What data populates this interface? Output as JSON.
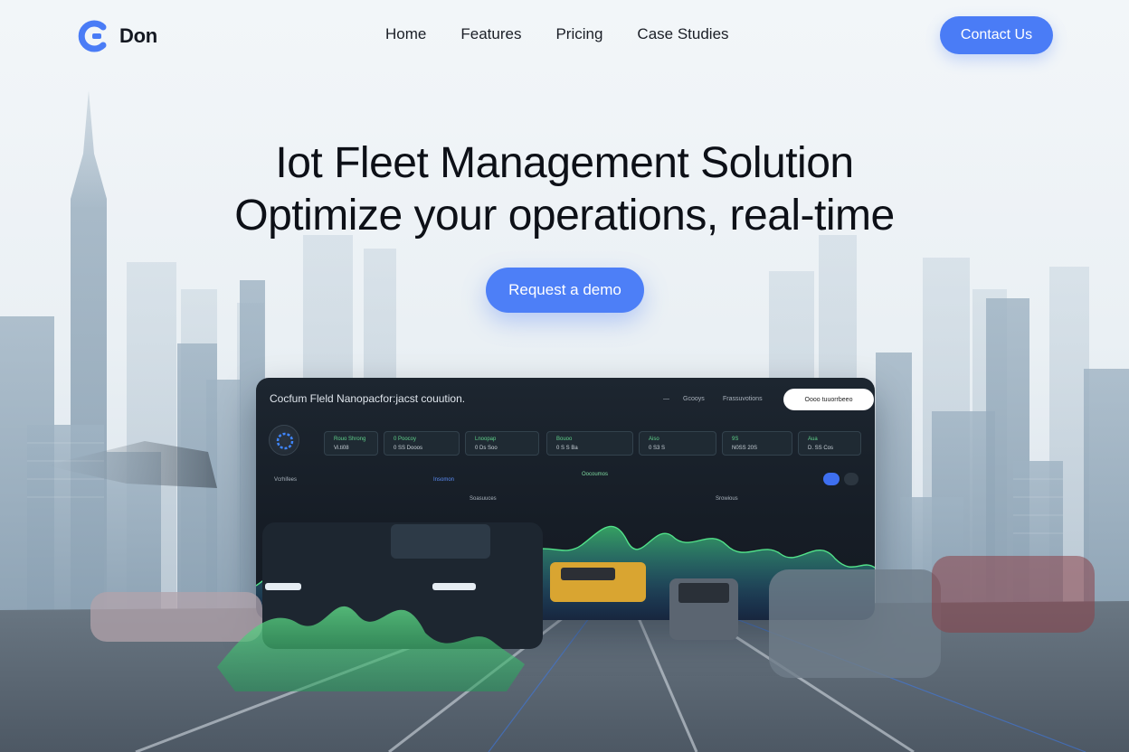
{
  "brand": {
    "name": "Don",
    "accent": "#4a7cf6"
  },
  "nav": {
    "links": [
      "Home",
      "Features",
      "Pricing",
      "Case Studies"
    ],
    "cta": "Contact Us"
  },
  "hero": {
    "line1": "Iot Fleet Management Solution",
    "line2": "Optimize your operations, real-time",
    "cta": "Request a demo"
  },
  "dashboard": {
    "title": "Cocfum Fleld Nanopacfor:jacst couution.",
    "nav_items": [
      "Gcooys",
      "Frassuvotions"
    ],
    "pill": "Oooo tuuorrbeeo",
    "stats": [
      {
        "label": "Rouo Shrong",
        "value": "Vi.ti08"
      },
      {
        "label": "0 Poocoy",
        "value": "0 SS Dooos"
      },
      {
        "label": "Lnoopap",
        "value": "0 Ds Soo"
      },
      {
        "label": "Bouoo",
        "value": "0 S S Ba"
      },
      {
        "label": "Aiso",
        "value": "0 S3 S"
      },
      {
        "label": "9S",
        "value": "N0SS 20S"
      },
      {
        "label": "Aua",
        "value": "D. SS Cos"
      }
    ],
    "sub_labels": [
      "Vcrhifees",
      "Insomon",
      "Oocoumos",
      "Soasuuces",
      "Srowious"
    ]
  }
}
